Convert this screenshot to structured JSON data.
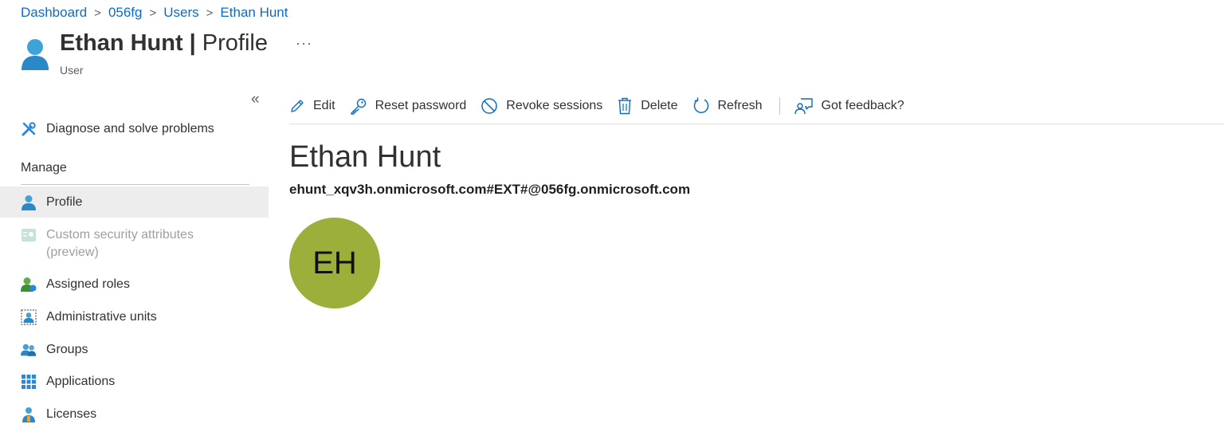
{
  "breadcrumb": {
    "items": [
      "Dashboard",
      "056fg",
      "Users",
      "Ethan Hunt"
    ],
    "separator": ">"
  },
  "header": {
    "title_name": "Ethan Hunt",
    "title_sep": "|",
    "title_section": "Profile",
    "subtitle": "User",
    "more": "···"
  },
  "sidebar": {
    "collapse": "«",
    "diagnose_label": "Diagnose and solve problems",
    "section_label": "Manage",
    "items": [
      {
        "label": "Profile",
        "icon": "user-icon"
      },
      {
        "label": "Custom security attributes",
        "label2": "(preview)",
        "icon": "security-attributes-icon"
      },
      {
        "label": "Assigned roles",
        "icon": "assigned-roles-icon"
      },
      {
        "label": "Administrative units",
        "icon": "administrative-units-icon"
      },
      {
        "label": "Groups",
        "icon": "groups-icon"
      },
      {
        "label": "Applications",
        "icon": "applications-icon"
      },
      {
        "label": "Licenses",
        "icon": "licenses-icon"
      }
    ]
  },
  "toolbar": {
    "edit": "Edit",
    "reset_password": "Reset password",
    "revoke_sessions": "Revoke sessions",
    "delete": "Delete",
    "refresh": "Refresh",
    "feedback": "Got feedback?"
  },
  "profile": {
    "display_name": "Ethan Hunt",
    "upn": "ehunt_xqv3h.onmicrosoft.com#EXT#@056fg.onmicrosoft.com",
    "initials": "EH",
    "avatar_color": "#9caf3b"
  },
  "colors": {
    "accent": "#0f6cbd",
    "selected_bg": "#ededed"
  }
}
